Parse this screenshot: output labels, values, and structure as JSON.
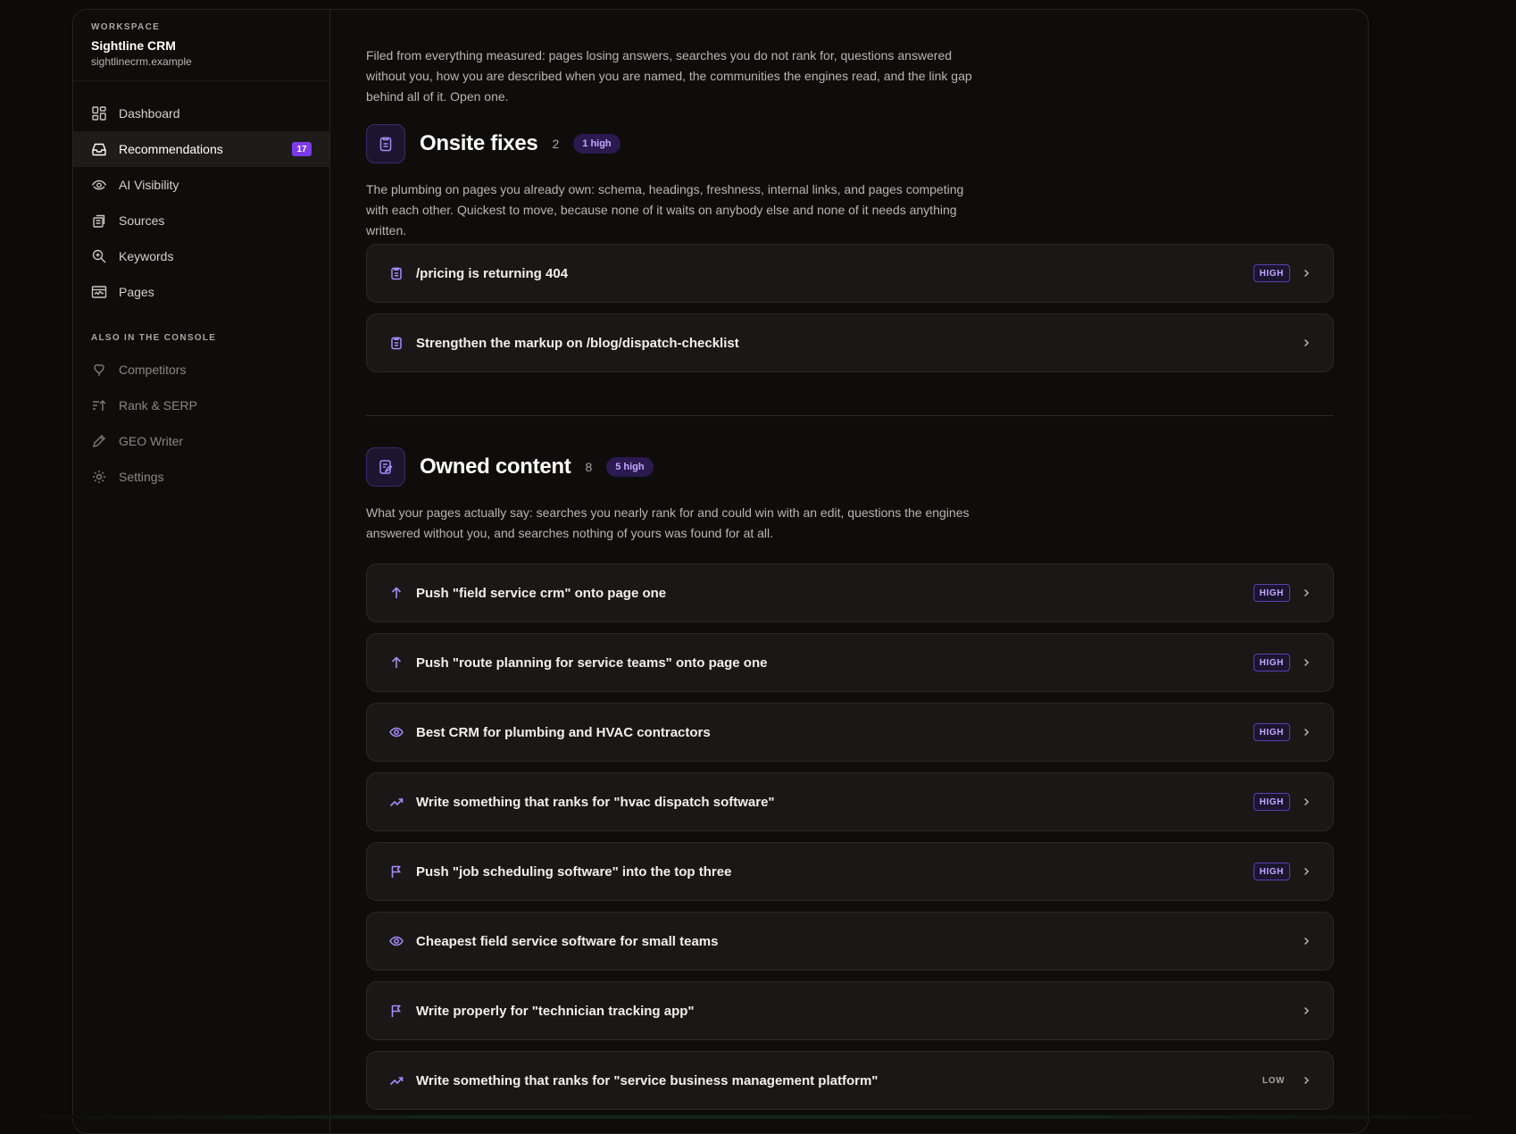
{
  "workspace": {
    "eyebrow": "WORKSPACE",
    "name": "Sightline CRM",
    "domain": "sightlinecrm.example"
  },
  "nav": {
    "items": [
      {
        "label": "Dashboard",
        "icon": "dashboard-icon"
      },
      {
        "label": "Recommendations",
        "icon": "inbox-icon",
        "badge": "17",
        "active": true
      },
      {
        "label": "AI Visibility",
        "icon": "eye-icon"
      },
      {
        "label": "Sources",
        "icon": "sources-icon"
      },
      {
        "label": "Keywords",
        "icon": "search-icon"
      },
      {
        "label": "Pages",
        "icon": "pages-icon"
      }
    ],
    "section_label": "ALSO IN THE CONSOLE",
    "secondary": [
      {
        "label": "Competitors",
        "icon": "competitors-icon"
      },
      {
        "label": "Rank & SERP",
        "icon": "rank-icon"
      },
      {
        "label": "GEO Writer",
        "icon": "pen-icon"
      },
      {
        "label": "Settings",
        "icon": "gear-icon"
      }
    ]
  },
  "intro": "Filed from everything measured: pages losing answers, searches you do not rank for, questions answered without you, how you are described when you are named, the communities the engines read, and the link gap behind all of it. Open one.",
  "sections": [
    {
      "title": "Onsite fixes",
      "count": "2",
      "pill": "1 high",
      "icon": "clipboard-icon",
      "description": "The plumbing on pages you already own: schema, headings, freshness, internal links, and pages competing with each other. Quickest to move, because none of it waits on anybody else and none of it needs anything written.",
      "cards": [
        {
          "title": "/pricing is returning 404",
          "icon": "clipboard-icon",
          "priority": "HIGH"
        },
        {
          "title": "Strengthen the markup on /blog/dispatch-checklist",
          "icon": "clipboard-icon",
          "priority": ""
        }
      ]
    },
    {
      "title": "Owned content",
      "count": "8",
      "pill": "5 high",
      "icon": "document-edit-icon",
      "description": "What your pages actually say: searches you nearly rank for and could win with an edit, questions the engines answered without you, and searches nothing of yours was found for at all.",
      "cards": [
        {
          "title": "Push \"field service crm\" onto page one",
          "icon": "arrow-up-icon",
          "priority": "HIGH"
        },
        {
          "title": "Push \"route planning for service teams\" onto page one",
          "icon": "arrow-up-icon",
          "priority": "HIGH"
        },
        {
          "title": "Best CRM for plumbing and HVAC contractors",
          "icon": "eye-icon",
          "priority": "HIGH"
        },
        {
          "title": "Write something that ranks for \"hvac dispatch software\"",
          "icon": "trend-up-icon",
          "priority": "HIGH"
        },
        {
          "title": "Push \"job scheduling software\" into the top three",
          "icon": "flag-icon",
          "priority": "HIGH"
        },
        {
          "title": "Cheapest field service software for small teams",
          "icon": "eye-icon",
          "priority": ""
        },
        {
          "title": "Write properly for \"technician tracking app\"",
          "icon": "flag-icon",
          "priority": ""
        },
        {
          "title": "Write something that ranks for \"service business management platform\"",
          "icon": "trend-up-icon",
          "priority": "LOW"
        }
      ]
    }
  ],
  "colors": {
    "accent": "#7c3aed",
    "accent_light": "#a78bfa",
    "background": "#0f0d0c",
    "card": "#1a1817"
  }
}
